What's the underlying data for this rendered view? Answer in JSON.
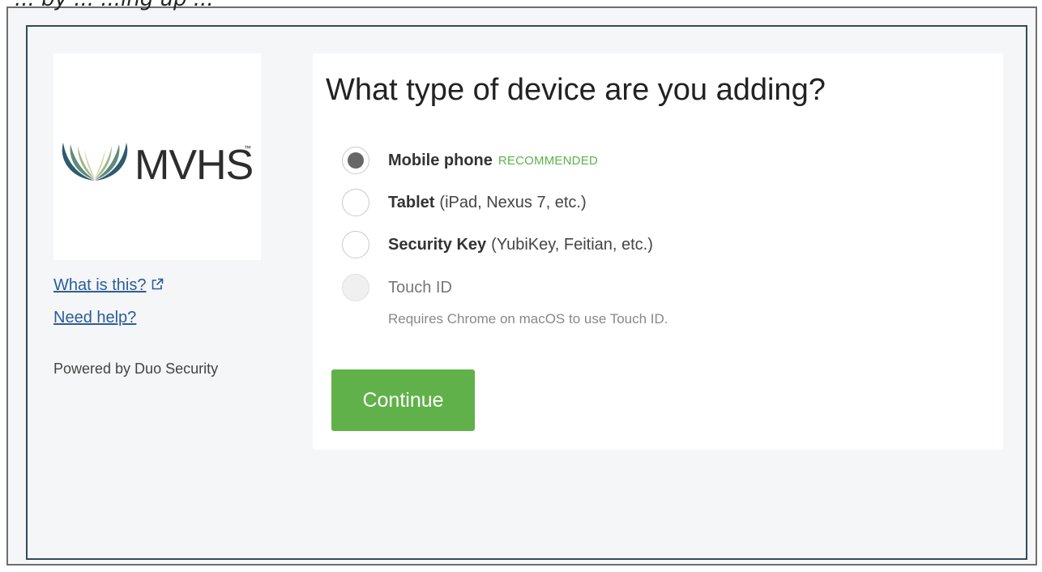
{
  "caption": "... by ... ...ing up ...",
  "branding": {
    "logo_text": "MVHS",
    "trademark": "™"
  },
  "sidebar": {
    "what_is_this": "What is this?",
    "need_help": "Need help?",
    "powered_by": "Powered by Duo Security"
  },
  "dialog": {
    "title": "What type of device are you adding?",
    "options": [
      {
        "label": "Mobile phone",
        "detail": "",
        "badge": "RECOMMENDED",
        "selected": true,
        "disabled": false
      },
      {
        "label": "Tablet",
        "detail": "(iPad, Nexus 7, etc.)",
        "badge": "",
        "selected": false,
        "disabled": false
      },
      {
        "label": "Security Key",
        "detail": "(YubiKey, Feitian, etc.)",
        "badge": "",
        "selected": false,
        "disabled": false
      },
      {
        "label": "Touch ID",
        "detail": "",
        "badge": "",
        "selected": false,
        "disabled": true
      }
    ],
    "touch_id_note": "Requires Chrome on macOS to use Touch ID.",
    "continue_label": "Continue"
  },
  "colors": {
    "accent_green": "#60b14a",
    "recommended_green": "#5cb34a",
    "link_blue": "#2b5d9a",
    "frame_navy": "#35495c"
  },
  "icons": {
    "external_link": "external-link-icon",
    "logo_mark": "mvhs-wings-logo"
  }
}
